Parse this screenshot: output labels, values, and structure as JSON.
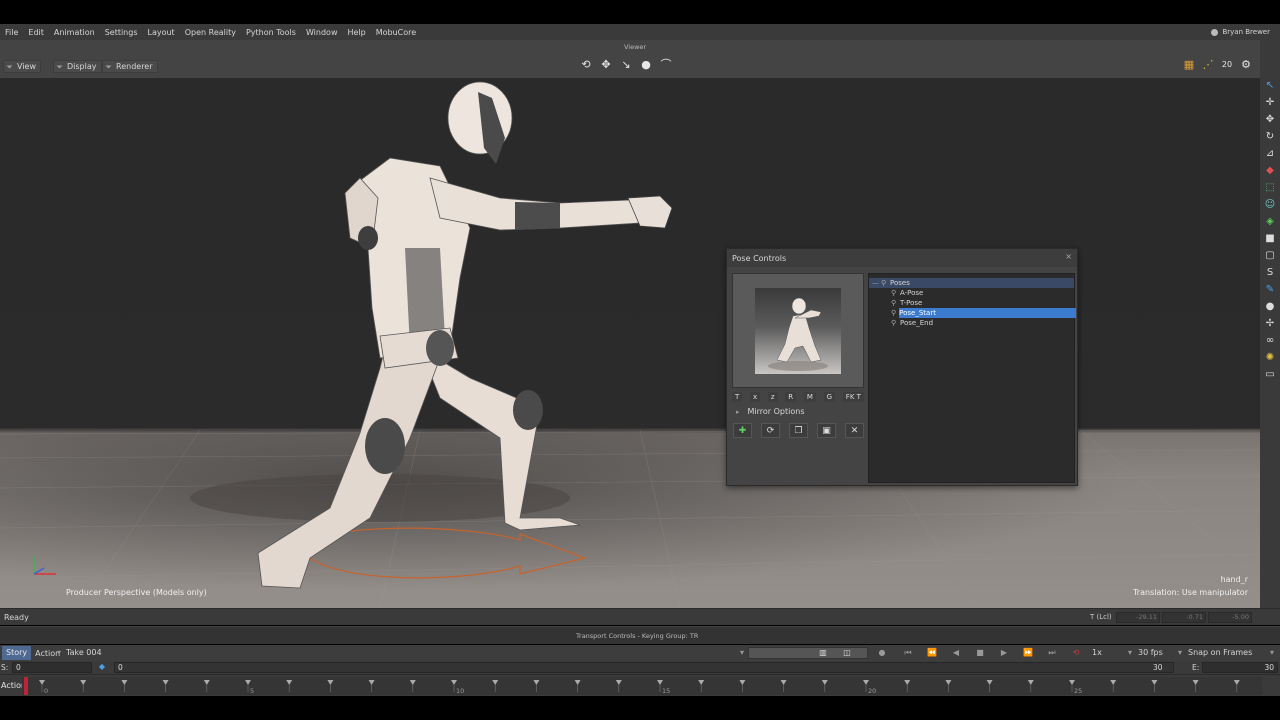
{
  "menubar": {
    "items": [
      "File",
      "Edit",
      "Animation",
      "Settings",
      "Layout",
      "Open Reality",
      "Python Tools",
      "Window",
      "Help",
      "MobuCore"
    ],
    "user_name": "Bryan Brewer"
  },
  "viewer": {
    "title": "Viewer",
    "buttons": [
      "View",
      "Display",
      "Renderer"
    ],
    "camera_label": "Producer Perspective (Models only)",
    "selected_model": "hand_r",
    "manipulator_status": "Translation: Use manipulator",
    "counter": "20"
  },
  "pose_controls": {
    "title": "Pose Controls",
    "close": "×",
    "trs_buttons": [
      "T",
      "x",
      "z",
      "R",
      "M",
      "G",
      "FK T"
    ],
    "mirror_options_label": "Mirror Options",
    "tree_root": "Poses",
    "poses": [
      "A-Pose",
      "T-Pose",
      "Pose_Start",
      "Pose_End"
    ],
    "selected_pose": "Pose_Start"
  },
  "status": {
    "ready": "Ready",
    "t_label": "T (Lcl)",
    "values": [
      "-29.11",
      "-0.71",
      "-5.00"
    ]
  },
  "transport": {
    "title": "Transport Controls  -  Keying Group: TR",
    "mode_story": "Story",
    "mode_action": "Action",
    "take": "Take 004",
    "speed": "1x",
    "fps": "30 fps",
    "snap": "Snap on Frames",
    "start_label": "S:",
    "start_value": "0",
    "current_frame": "0",
    "end_label": "E:",
    "end_value": "30",
    "end_frame_right": "30"
  },
  "story_track": {
    "label": "Action",
    "tick_numbers": [
      "0",
      "5",
      "10",
      "15",
      "20",
      "25"
    ]
  }
}
